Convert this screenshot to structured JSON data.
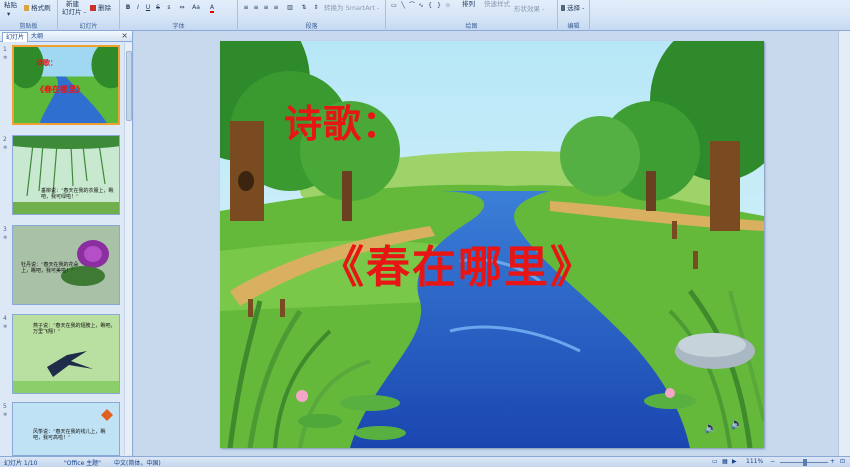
{
  "ribbon": {
    "clipboard": {
      "paste": "粘贴",
      "format_painter": "格式刷",
      "label": "剪贴板"
    },
    "slides": {
      "new_slide": "新建",
      "new_slide_2": "幻灯片 -",
      "delete": "删除",
      "label": "幻灯片"
    },
    "font": {
      "label": "字体"
    },
    "paragraph": {
      "convert_smartart": "转换为 SmartArt -",
      "label": "段落"
    },
    "drawing": {
      "arrange": "排列",
      "quick_styles": "快速样式",
      "shape_effects": "形状效果 -",
      "label": "绘图"
    },
    "editing": {
      "select": "选择 -",
      "label": "编辑"
    }
  },
  "panel": {
    "tab_slides": "幻灯片",
    "tab_outline": "大纲",
    "close": "×",
    "thumbnails": [
      {
        "num": "1",
        "text_a": "诗歌：",
        "text_b": "《春在哪里》"
      },
      {
        "num": "2",
        "text": "垂柳说：“春天在我的衣服上，瞧吧，我可绿啦！”"
      },
      {
        "num": "3",
        "text": "牡丹说：“春天在我的花朵上，瞧吧，我可美啦！”"
      },
      {
        "num": "4",
        "text": "燕子说：“春天在我的翅膀上，瞧吧，万里飞翔！”"
      },
      {
        "num": "5",
        "text": "风筝说：“春天在我的线儿上，瞧吧，我可高啦！”"
      }
    ]
  },
  "slide": {
    "title_line1": "诗歌：",
    "title_line2": "《春在哪里》"
  },
  "status": {
    "slide_info": "幻灯片 1/10",
    "theme": "\"Office 主题\"",
    "language": "中文(简体，中国)",
    "zoom": "111%"
  },
  "colors": {
    "title_red": "#e81515",
    "ribbon_blue": "#15428b"
  }
}
